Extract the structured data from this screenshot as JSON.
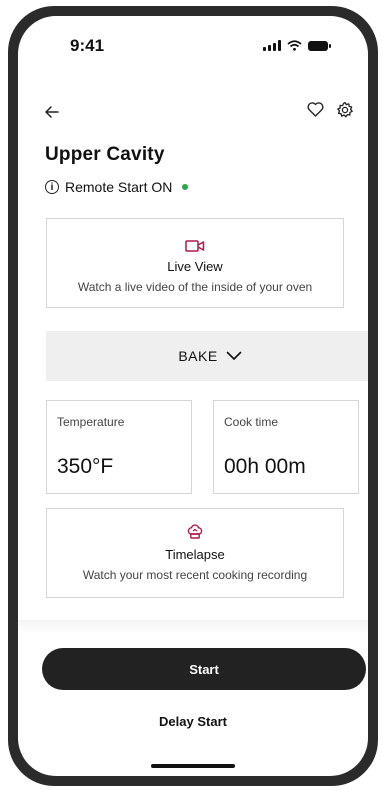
{
  "status_bar": {
    "time": "9:41"
  },
  "header": {
    "title": "Upper  Cavity"
  },
  "remote": {
    "label": "Remote Start ON",
    "dot_color": "#2aa84a"
  },
  "live_view": {
    "title": "Live View",
    "subtitle": "Watch a live video of the inside of your oven"
  },
  "mode": {
    "label": "BAKE"
  },
  "temperature": {
    "label": "Temperature",
    "value": "350°F"
  },
  "cook_time": {
    "label": "Cook time",
    "value": "00h 00m"
  },
  "timelapse": {
    "title": "Timelapse",
    "subtitle": "Watch your most recent cooking recording"
  },
  "actions": {
    "start_label": "Start",
    "delay_label": "Delay Start"
  },
  "colors": {
    "accent": "#b0184c",
    "primary_button": "#222222"
  },
  "icons": [
    "signal-icon",
    "wifi-icon",
    "battery-icon",
    "back-arrow-icon",
    "heart-icon",
    "gear-icon",
    "info-icon",
    "video-camera-icon",
    "chevron-down-icon",
    "chef-hat-icon"
  ]
}
